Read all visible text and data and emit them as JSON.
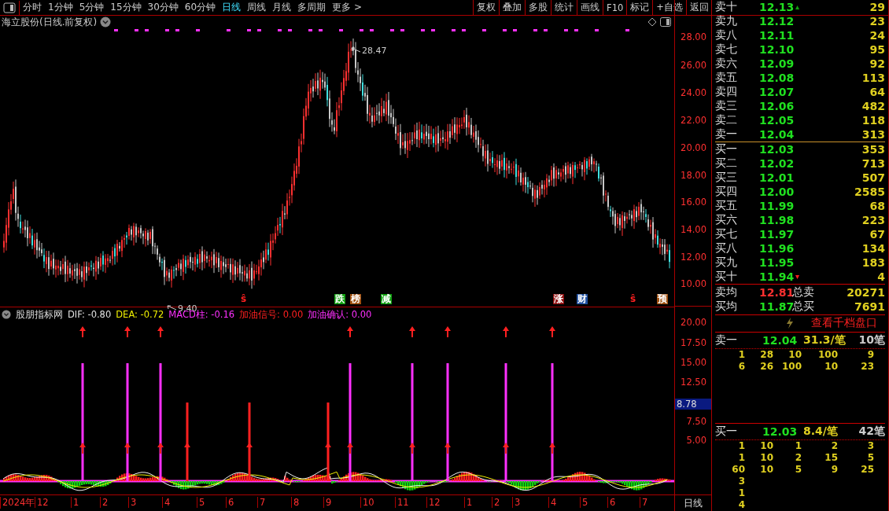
{
  "toolbar": {
    "periods": [
      {
        "label": "分时",
        "selected": false
      },
      {
        "label": "1分钟",
        "selected": false
      },
      {
        "label": "5分钟",
        "selected": false
      },
      {
        "label": "15分钟",
        "selected": false
      },
      {
        "label": "30分钟",
        "selected": false
      },
      {
        "label": "60分钟",
        "selected": false
      },
      {
        "label": "日线",
        "selected": true
      },
      {
        "label": "周线",
        "selected": false
      },
      {
        "label": "月线",
        "selected": false
      },
      {
        "label": "多周期",
        "selected": false
      },
      {
        "label": "更多 >",
        "selected": false
      }
    ],
    "buttons": [
      "复权",
      "叠加",
      "多股",
      "统计",
      "画线",
      "F10",
      "标记",
      "+自选",
      "返回"
    ]
  },
  "chart": {
    "title": "海立股份(日线.前复权)",
    "high_label": "28.47",
    "low_label": "9.40",
    "price_ticks": [
      "28.00",
      "26.00",
      "24.00",
      "22.00",
      "20.00",
      "18.00",
      "16.00",
      "14.00",
      "12.00",
      "10.00"
    ],
    "events": [
      {
        "label": "ŝ",
        "color": "#ff2020"
      },
      {
        "label": "跌",
        "color": "#10a010"
      },
      {
        "label": "榜",
        "color": "#a05010"
      },
      {
        "label": "减",
        "color": "#10a010"
      },
      {
        "label": "涨",
        "color": "#901010"
      },
      {
        "label": "财",
        "color": "#2050a0"
      },
      {
        "label": "ŝ",
        "color": "#ff2020"
      },
      {
        "label": "预",
        "color": "#a05010"
      }
    ]
  },
  "indicator": {
    "name": "股朋指标网",
    "values": [
      {
        "label": "DIF: -0.80",
        "color": "#e0e0e0"
      },
      {
        "label": "DEA: -0.72",
        "color": "#f0f000"
      },
      {
        "label": "MACD柱: -0.16",
        "color": "#ff30ff"
      },
      {
        "label": "加油信号: 0.00",
        "color": "#ff2020"
      },
      {
        "label": "加油确认: 0.00",
        "color": "#ff30ff"
      }
    ],
    "ticks": [
      "20.00",
      "17.50",
      "15.00",
      "12.50",
      "7.50",
      "5.00"
    ],
    "current": "8.78"
  },
  "time_axis": {
    "labels": [
      "2024年",
      "12",
      "1",
      "2",
      "3",
      "4",
      "5",
      "6",
      "7",
      "8",
      "9",
      "10",
      "11",
      "12",
      "1",
      "2",
      "3",
      "4",
      "5",
      "6",
      "7"
    ],
    "period": "日线"
  },
  "order_book": {
    "rows": [
      {
        "label": "卖十",
        "price": "12.13",
        "volume": "29",
        "mark": {
          "glyph": "▴",
          "color": "#10a010"
        }
      },
      {
        "label": "卖九",
        "price": "12.12",
        "volume": "23"
      },
      {
        "label": "卖八",
        "price": "12.11",
        "volume": "24"
      },
      {
        "label": "卖七",
        "price": "12.10",
        "volume": "95"
      },
      {
        "label": "卖六",
        "price": "12.09",
        "volume": "92"
      },
      {
        "label": "卖五",
        "price": "12.08",
        "volume": "113"
      },
      {
        "label": "卖四",
        "price": "12.07",
        "volume": "64"
      },
      {
        "label": "卖三",
        "price": "12.06",
        "volume": "482"
      },
      {
        "label": "卖二",
        "price": "12.05",
        "volume": "118"
      },
      {
        "label": "卖一",
        "price": "12.04",
        "volume": "313"
      },
      {
        "label": "买一",
        "price": "12.03",
        "volume": "353"
      },
      {
        "label": "买二",
        "price": "12.02",
        "volume": "713"
      },
      {
        "label": "买三",
        "price": "12.01",
        "volume": "507"
      },
      {
        "label": "买四",
        "price": "12.00",
        "volume": "2585"
      },
      {
        "label": "买五",
        "price": "11.99",
        "volume": "68"
      },
      {
        "label": "买六",
        "price": "11.98",
        "volume": "223"
      },
      {
        "label": "买七",
        "price": "11.97",
        "volume": "67"
      },
      {
        "label": "买八",
        "price": "11.96",
        "volume": "134"
      },
      {
        "label": "买九",
        "price": "11.95",
        "volume": "183"
      },
      {
        "label": "买十",
        "price": "11.94",
        "volume": "4",
        "mark": {
          "glyph": "▾",
          "color": "#ff2020"
        }
      }
    ],
    "summary": [
      {
        "label": "卖均",
        "price": "12.81",
        "color": "#ff3030",
        "total_label": "总卖",
        "total": "20271"
      },
      {
        "label": "买均",
        "price": "11.87",
        "color": "#20e020",
        "total_label": "总买",
        "total": "7691"
      }
    ]
  },
  "depth_link": "查看千档盘口",
  "queues": [
    {
      "label": "卖一",
      "price": "12.04",
      "avg": "31.3/笔",
      "count": "10笔",
      "rows": [
        [
          "1",
          "28",
          "10",
          "100",
          "9"
        ],
        [
          "6",
          "26",
          "100",
          "10",
          "23"
        ]
      ]
    },
    {
      "label": "买一",
      "price": "12.03",
      "avg": "8.4/笔",
      "count": "42笔",
      "rows": [
        [
          "1",
          "10",
          "1",
          "2",
          "3"
        ],
        [
          "1",
          "10",
          "2",
          "15",
          "5"
        ],
        [
          "60",
          "10",
          "5",
          "9",
          "25"
        ],
        [
          "3"
        ],
        [
          "1"
        ],
        [
          "4"
        ]
      ]
    }
  ]
}
